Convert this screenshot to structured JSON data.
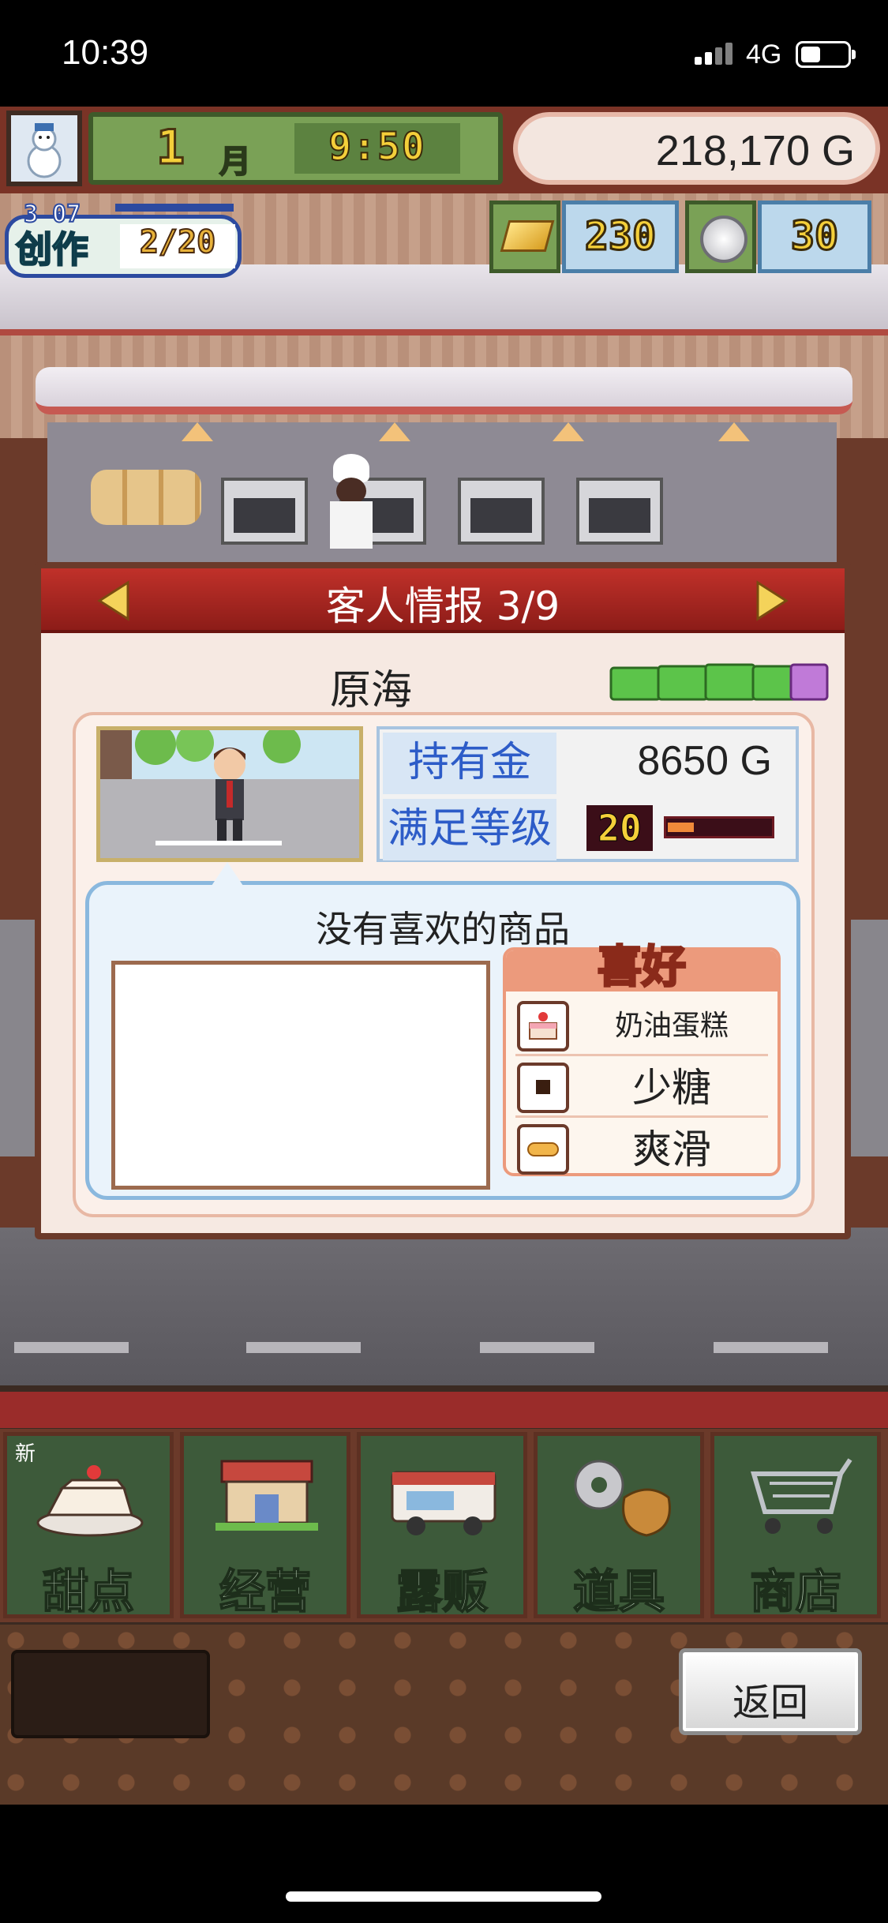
{
  "status_bar": {
    "time": "10:39",
    "network": "4G"
  },
  "hud": {
    "month": "1",
    "month_label": "月",
    "time": "9:50",
    "money": "218,170 G",
    "create": {
      "rank": "3 07",
      "label": "创作",
      "count": "2/20"
    },
    "ingots": "230",
    "coins": "30"
  },
  "customer_info": {
    "title": "客人情报 3/9",
    "name": "原海",
    "wealth_label": "持有金",
    "wealth": "8650 G",
    "satisfaction_label": "满足等级",
    "satisfaction_level": "20",
    "satisfaction_progress": 0.25,
    "no_favorite_text": "没有喜欢的商品",
    "preferences_title": "喜好",
    "preferences": [
      {
        "icon": "cake-icon",
        "text": "奶油蛋糕"
      },
      {
        "icon": "square-dot-icon",
        "text": "少糖"
      },
      {
        "icon": "bread-icon",
        "text": "爽滑"
      }
    ]
  },
  "nav": {
    "new_badge": "新",
    "items": [
      {
        "label": "甜点",
        "icon": "cake-icon"
      },
      {
        "label": "经营",
        "icon": "shop-icon"
      },
      {
        "label": "露贩",
        "icon": "food-truck-icon"
      },
      {
        "label": "道具",
        "icon": "gear-bag-icon"
      },
      {
        "label": "商店",
        "icon": "cart-icon"
      }
    ]
  },
  "back_label": "返回"
}
